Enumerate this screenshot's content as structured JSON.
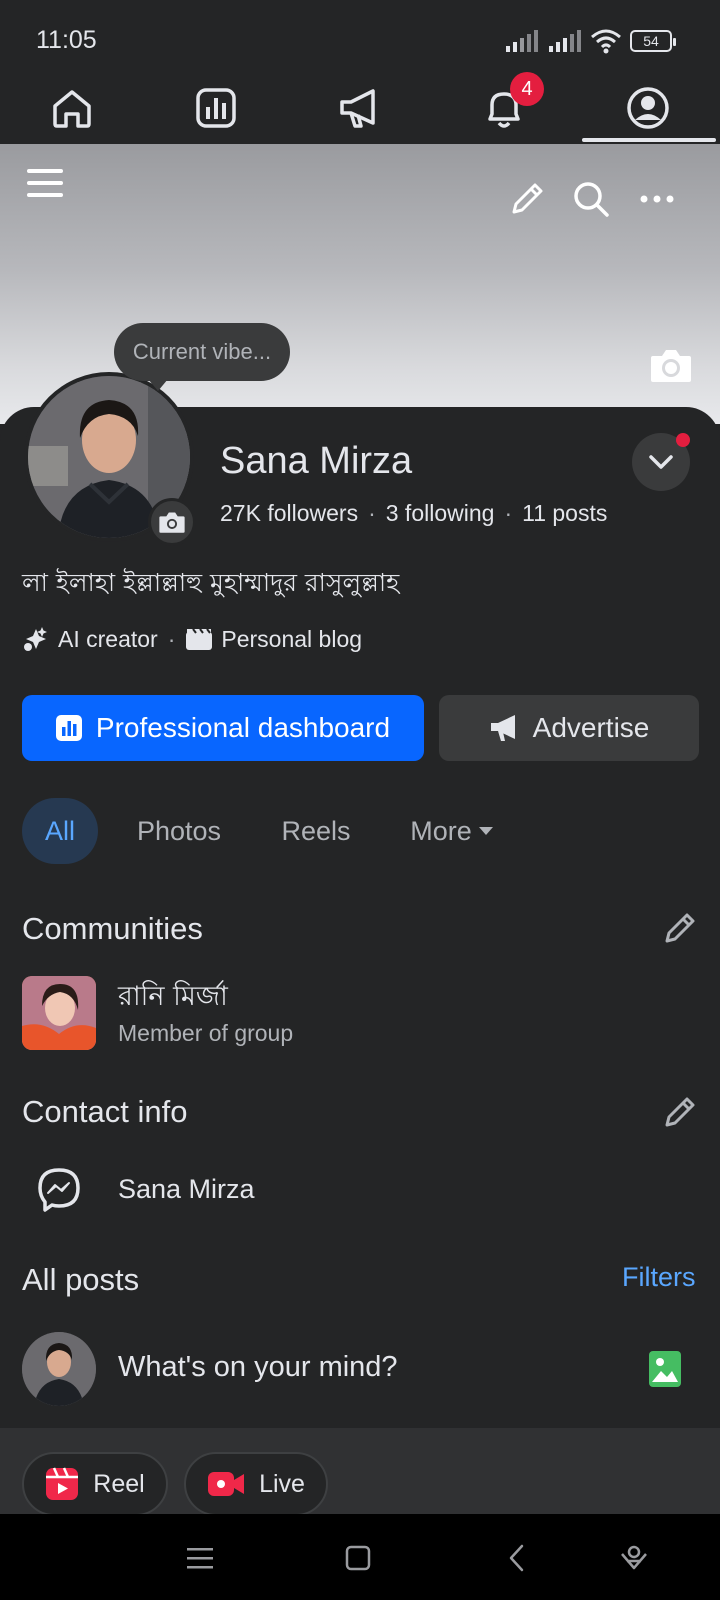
{
  "status_bar": {
    "time": "11:05",
    "battery": "54"
  },
  "nav": {
    "tabs": [
      "home",
      "dashboard",
      "ads",
      "notifications",
      "profile"
    ],
    "notification_count": "4",
    "active": "profile"
  },
  "cover": {
    "vibe_placeholder": "Current vibe..."
  },
  "profile": {
    "name": "Sana Mirza",
    "followers": "27K followers",
    "following": "3 following",
    "posts": "11 posts",
    "bio": "লা ইলাহা ইল্লাল্লাহু মুহাম্মাদুর রাসুলুল্লাহ",
    "tag_1": "AI creator",
    "tag_2": "Personal blog"
  },
  "actions": {
    "primary": "Professional dashboard",
    "secondary": "Advertise"
  },
  "filters_row": {
    "all": "All",
    "photos": "Photos",
    "reels": "Reels",
    "more": "More"
  },
  "communities": {
    "title": "Communities",
    "items": [
      {
        "name": "রানি মির্জা",
        "role": "Member of group"
      }
    ]
  },
  "contact": {
    "title": "Contact info",
    "messenger_name": "Sana Mirza"
  },
  "posts": {
    "title": "All posts",
    "filters": "Filters",
    "composer_placeholder": "What's on your mind?"
  },
  "composer_actions": {
    "reel": "Reel",
    "live": "Live"
  },
  "colors": {
    "accent": "#0866ff",
    "link": "#5aa7ff",
    "badge": "#e41e3f",
    "bg": "#242526",
    "surface": "#3a3b3c"
  }
}
